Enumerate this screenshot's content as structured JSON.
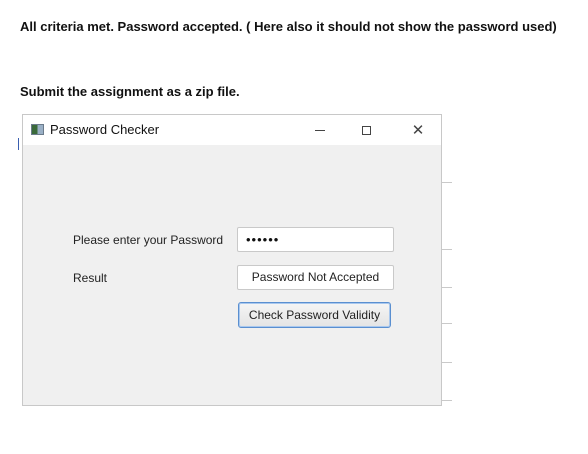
{
  "document": {
    "line1": "All criteria met. Password accepted. ( Here also it should not show the password used)",
    "line2": "Submit the assignment as a zip file."
  },
  "window": {
    "title": "Password Checker",
    "controls": [
      "minimize-icon",
      "maximize-icon",
      "close-icon"
    ],
    "close_glyph": "✕"
  },
  "form": {
    "password_label": "Please enter your Password",
    "password_value": "••••••",
    "result_label": "Result",
    "result_value": "Password Not Accepted",
    "check_button_label": "Check Password Validity"
  }
}
